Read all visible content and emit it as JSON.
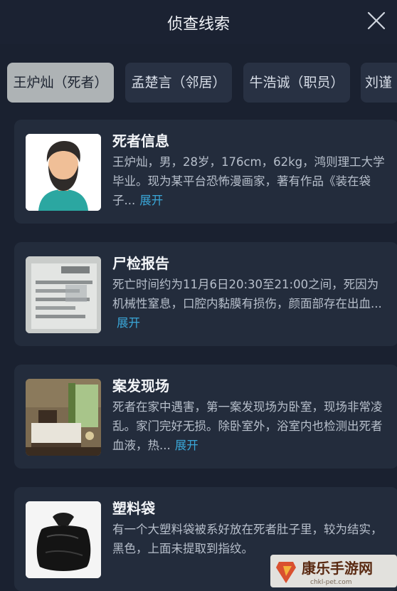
{
  "header": {
    "title": "侦查线索",
    "close_icon": "close-icon"
  },
  "tabs": [
    {
      "label": "王炉灿（死者）",
      "active": true
    },
    {
      "label": "孟楚言（邻居）",
      "active": false
    },
    {
      "label": "牛浩诚（职员）",
      "active": false
    },
    {
      "label": "刘谨",
      "active": false
    }
  ],
  "cards": [
    {
      "title": "死者信息",
      "desc": "王炉灿，男，28岁，176cm，62kg，鸿则理工大学毕业。现为某平台恐怖漫画家，著有作品《装在袋子...",
      "more": "展开",
      "thumb": "avatar-man-illustration"
    },
    {
      "title": "尸检报告",
      "desc": "死亡时间约为11月6日20:30至21:00之间，死因为机械性窒息，口腔内黏膜有损伤，颜面部存在出血...",
      "more": "展开",
      "thumb": "report-paper-photo"
    },
    {
      "title": "案发现场",
      "desc": "死者在家中遇害，第一案发现场为卧室，现场非常凌乱。家门完好无损。除卧室外，浴室内也检测出死者血液，热...",
      "more": "展开",
      "thumb": "bedroom-photo"
    },
    {
      "title": "塑料袋",
      "desc": "有一个大塑料袋被系好放在死者肚子里，较为结实，黑色，上面未提取到指纹。",
      "more": "",
      "thumb": "black-bag-photo"
    }
  ],
  "watermark": {
    "text": "康乐手游网",
    "url": "chkl-pet.com"
  }
}
